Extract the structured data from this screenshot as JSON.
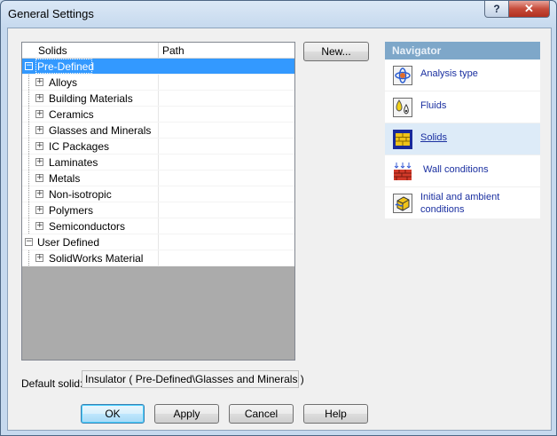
{
  "window": {
    "title": "General Settings",
    "help_glyph": "?",
    "close_glyph": "✕"
  },
  "tree": {
    "columns": [
      "Solids",
      "Path"
    ],
    "rows": [
      {
        "label": "Pre-Defined",
        "expander": "−",
        "selected": true
      },
      {
        "label": "Alloys",
        "expander": "+"
      },
      {
        "label": "Building Materials",
        "expander": "+"
      },
      {
        "label": "Ceramics",
        "expander": "+"
      },
      {
        "label": "Glasses and Minerals",
        "expander": "+"
      },
      {
        "label": "IC Packages",
        "expander": "+"
      },
      {
        "label": "Laminates",
        "expander": "+"
      },
      {
        "label": "Metals",
        "expander": "+"
      },
      {
        "label": "Non-isotropic",
        "expander": "+"
      },
      {
        "label": "Polymers",
        "expander": "+"
      },
      {
        "label": "Semiconductors",
        "expander": "+"
      },
      {
        "label": "User Defined",
        "expander": "−"
      },
      {
        "label": "SolidWorks Material",
        "expander": "+"
      }
    ]
  },
  "buttons": {
    "new": "New...",
    "ok": "OK",
    "apply": "Apply",
    "cancel": "Cancel",
    "help": "Help"
  },
  "default_solid": {
    "label": "Default solid:",
    "value": "Insulator ( Pre-Defined\\Glasses and Minerals )"
  },
  "navigator": {
    "title": "Navigator",
    "items": [
      {
        "label": "Analysis type",
        "icon": "analysis-type-icon"
      },
      {
        "label": "Fluids",
        "icon": "fluids-icon"
      },
      {
        "label": "Solids",
        "icon": "solids-icon",
        "active": true
      },
      {
        "label": "Wall conditions",
        "icon": "wall-conditions-icon"
      },
      {
        "label_line1": "Initial and ambient",
        "label_line2": "conditions",
        "icon": "initial-conditions-icon"
      }
    ]
  },
  "colors": {
    "selection": "#3399ff",
    "navigator_header": "#7ea7c9",
    "navigator_link": "#1a2fa0",
    "close_button": "#c64b3a"
  }
}
